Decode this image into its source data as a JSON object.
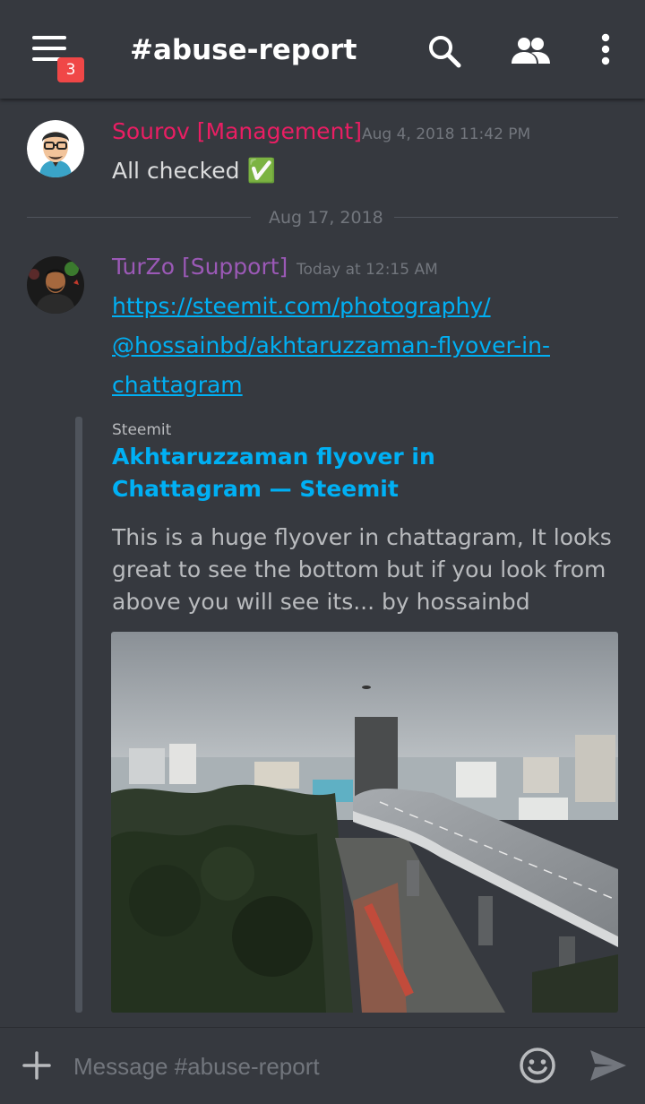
{
  "header": {
    "menu_badge": "3",
    "channel_title": "#abuse-report",
    "icons": [
      "menu-icon",
      "search-icon",
      "members-icon",
      "more-vertical-icon"
    ]
  },
  "messages": [
    {
      "author": "Sourov [Management]",
      "author_color": "#e91e63",
      "timestamp": "Aug 4, 2018 11:42 PM",
      "text": "All checked",
      "emoji": "✅"
    },
    {
      "author": "TurZo [Support]",
      "author_color": "#9b59b6",
      "timestamp": "Today at 12:15 AM",
      "link_lines": [
        "https://steemit.com/photography/",
        "@hossainbd/akhtaruzzaman-flyover-in-",
        "chattagram"
      ],
      "embed": {
        "provider": "Steemit",
        "title": "Akhtaruzzaman flyover in Chattagram — Steemit",
        "description": "This is a huge flyover in chattagram, It looks great to see the bottom but if you look from above you will see its... by hossainbd"
      }
    }
  ],
  "date_divider": "Aug 17, 2018",
  "composer": {
    "placeholder": "Message #abuse-report"
  },
  "colors": {
    "background": "#36393f",
    "link": "#00b0f4",
    "badge": "#f04747",
    "muted": "#72767d"
  }
}
